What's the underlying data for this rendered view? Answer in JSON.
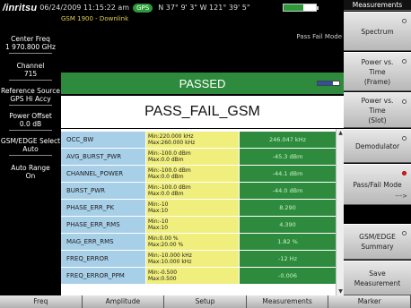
{
  "topbar": {
    "logo": "/inritsu",
    "datetime": "06/24/2009 11:15:22 am",
    "gps_badge": "GPS",
    "coords": "N 37° 9' 3\" W 121° 39' 5\""
  },
  "left_params": [
    {
      "label": "Center Freq",
      "value": "1 970.800 GHz"
    },
    {
      "label": "Channel",
      "value": "715"
    },
    {
      "label": "Reference Source",
      "value": "GPS Hi Accy"
    },
    {
      "label": "Power Offset",
      "value": "0.0 dB"
    },
    {
      "label": "GSM/EDGE Select",
      "value": "Auto"
    },
    {
      "label": "Auto Range",
      "value": "On"
    }
  ],
  "main": {
    "mode_line": "GSM 1900 - Downlink",
    "pass_fail_mode": "Pass Fail Mode",
    "status": "PASSED",
    "title": "PASS_FAIL_GSM",
    "rows": [
      {
        "name": "OCC_BW",
        "min": "Min:220.000 kHz",
        "max": "Max:260.000 kHz",
        "value": "246.047 kHz"
      },
      {
        "name": "AVG_BURST_PWR",
        "min": "Min:-100.0 dBm",
        "max": "Max:0.0 dBm",
        "value": "-45.3 dBm"
      },
      {
        "name": "CHANNEL_POWER",
        "min": "Min:-100.0 dBm",
        "max": "Max:0.0 dBm",
        "value": "-44.1 dBm"
      },
      {
        "name": "BURST_PWR",
        "min": "Min:-100.0 dBm",
        "max": "Max:0.0 dBm",
        "value": "-44.0 dBm"
      },
      {
        "name": "PHASE_ERR_PK",
        "min": "Min:-10",
        "max": "Max:10",
        "value": "8.290"
      },
      {
        "name": "PHASE_ERR_RMS",
        "min": "Min:-10",
        "max": "Max:10",
        "value": "4.390"
      },
      {
        "name": "MAG_ERR_RMS",
        "min": "Min:0.00 %",
        "max": "Max:20.00 %",
        "value": "1.82 %"
      },
      {
        "name": "FREQ_ERROR",
        "min": "Min:-10.000 kHz",
        "max": "Max:10.000 kHz",
        "value": "-12 Hz"
      },
      {
        "name": "FREQ_ERROR_PPM",
        "min": "Min:-0.500",
        "max": "Max:0.500",
        "value": "-0.006"
      }
    ]
  },
  "right": {
    "title": "Measurements",
    "keys": [
      {
        "l1": "Spectrum",
        "l2": "",
        "l3": ""
      },
      {
        "l1": "Power vs.",
        "l2": "Time",
        "l3": "(Frame)"
      },
      {
        "l1": "Power vs.",
        "l2": "Time",
        "l3": "(Slot)"
      },
      {
        "l1": "Demodulator",
        "l2": "",
        "l3": ""
      },
      {
        "l1": "Pass/Fail Mode",
        "l2": "",
        "l3": ""
      },
      {
        "l1": "GSM/EDGE",
        "l2": "Summary",
        "l3": ""
      },
      {
        "l1": "Save",
        "l2": "Measurement",
        "l3": ""
      }
    ],
    "more_arrow": "--->"
  },
  "bottom_keys": [
    "Freq",
    "Amplitude",
    "Setup",
    "Measurements",
    "Marker"
  ],
  "colors": {
    "pass_green": "#2e8b3e",
    "name_blue": "#a8cfe8",
    "limit_yellow": "#f0ee7c",
    "mode_yellow": "#e0d050"
  }
}
